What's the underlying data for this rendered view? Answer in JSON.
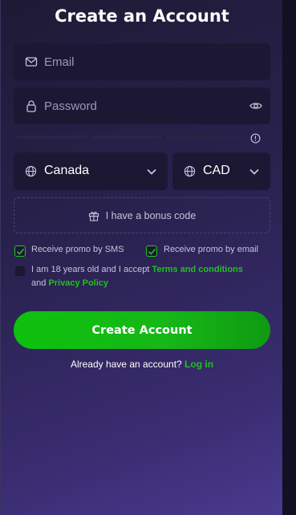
{
  "form": {
    "title": "Create an Account",
    "email": {
      "placeholder": "Email",
      "value": ""
    },
    "password": {
      "placeholder": "Password",
      "value": ""
    },
    "country": {
      "value": "Canada"
    },
    "currency": {
      "value": "CAD"
    },
    "bonus_label": "I have a bonus code",
    "promo_sms": {
      "label": "Receive promo by SMS",
      "checked": true
    },
    "promo_email": {
      "label": "Receive promo by email",
      "checked": true
    },
    "age_terms": {
      "checked": false,
      "prefix": "I am 18 years old and I accept ",
      "terms_link": "Terms and conditions",
      "and_text": "and ",
      "privacy_link": "Privacy Policy"
    },
    "submit_label": "Create Account",
    "login_prompt": "Already have an account?",
    "login_link": "Log in"
  },
  "colors": {
    "accent_green": "#1fc21f",
    "field_bg": "#1c1833",
    "panel_top": "#1e1a35",
    "panel_bottom": "#4a3a8e"
  },
  "icons": {
    "email": "mail-icon",
    "password": "lock-icon",
    "visibility": "eye-icon",
    "strength_info": "info-icon",
    "country": "globe-icon",
    "currency": "globe-icon",
    "dropdown": "chevron-down-icon",
    "bonus": "gift-icon",
    "checkbox": "check-icon"
  }
}
